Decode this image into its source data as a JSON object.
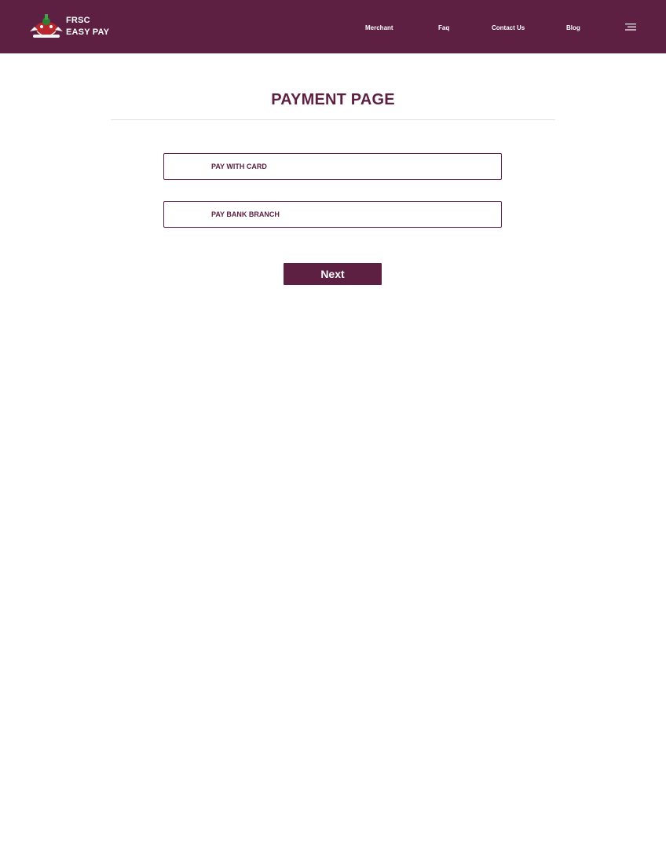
{
  "header": {
    "brand_line1": "FRSC",
    "brand_line2": "EASY PAY",
    "logo_icon": "frsc-crest-icon",
    "nav": [
      {
        "label": "Merchant"
      },
      {
        "label": "Faq"
      },
      {
        "label": "Contact Us"
      },
      {
        "label": "Blog"
      }
    ],
    "menu_icon": "hamburger-menu-icon"
  },
  "main": {
    "title": "PAYMENT PAGE",
    "options": [
      {
        "label": "PAY WITH CARD"
      },
      {
        "label": "PAY BANK BRANCH"
      }
    ],
    "next_label": "Next"
  },
  "colors": {
    "brand": "#5d1f42",
    "background": "#ffffff"
  }
}
